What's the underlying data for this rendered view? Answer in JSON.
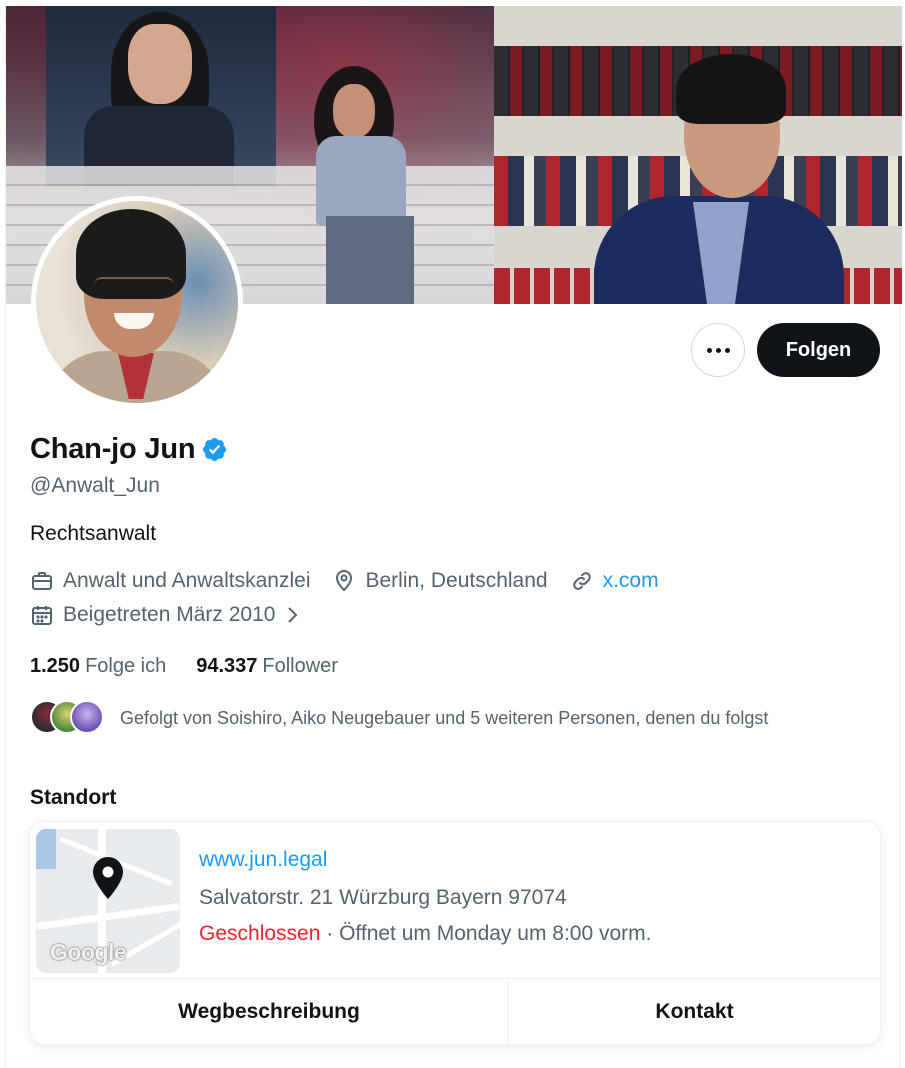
{
  "profile": {
    "name": "Chan-jo Jun",
    "handle": "@Anwalt_Jun",
    "bio": "Rechtsanwalt",
    "verified": true,
    "category": "Anwalt und Anwaltskanzlei",
    "location": "Berlin, Deutschland",
    "website": "x.com",
    "joined": "Beigetreten März 2010"
  },
  "actions": {
    "more_icon": "more-horizontal-icon",
    "follow_label": "Folgen"
  },
  "stats": {
    "following_count": "1.250",
    "following_label": "Folge ich",
    "followers_count": "94.337",
    "followers_label": "Follower"
  },
  "followed_by": {
    "text": "Gefolgt von Soishiro, Aiko Neugebauer und 5 weiteren Personen, denen du folgst"
  },
  "location_section": {
    "title": "Standort",
    "website": "www.jun.legal",
    "address": "Salvatorstr. 21 Würzburg Bayern 97074",
    "status": "Geschlossen",
    "hours": " · Öffnet um Monday um 8:00 vorm.",
    "map_label": "Google",
    "directions_label": "Wegbeschreibung",
    "contact_label": "Kontakt"
  },
  "colors": {
    "accent": "#1d9bf0",
    "text_primary": "#0f1419",
    "text_secondary": "#536471",
    "closed": "#f4212e",
    "follow_button_bg": "#0f1419"
  }
}
